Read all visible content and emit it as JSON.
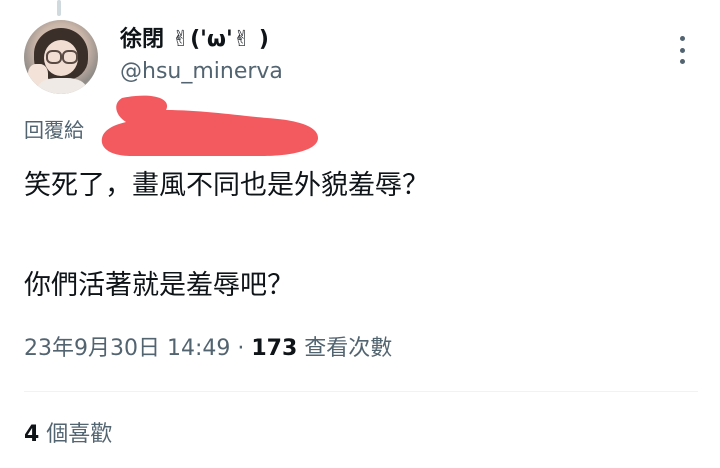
{
  "author": {
    "display_name": "徐閉 ✌('ω'✌ )",
    "handle": "@hsu_minerva"
  },
  "reply": {
    "label": "回覆給"
  },
  "tweet": {
    "line1": "笑死了，畫風不同也是外貌羞辱？",
    "line2": "你們活著就是羞辱吧？"
  },
  "meta": {
    "timestamp": "23年9月30日 14:49",
    "separator": " · ",
    "views_count": "173",
    "views_label": " 查看次數"
  },
  "likes": {
    "count": "4",
    "label": " 個喜歡"
  },
  "colors": {
    "redaction": "#f35a5f",
    "secondary_text": "#536471",
    "primary_text": "#0f1419"
  },
  "icons": {
    "more": "more-vertical-icon"
  }
}
